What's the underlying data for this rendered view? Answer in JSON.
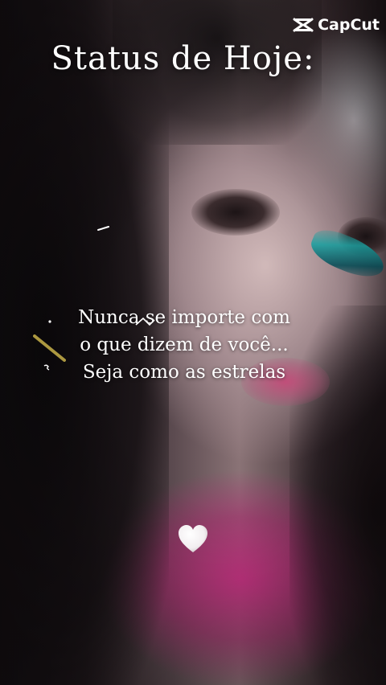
{
  "watermark": {
    "brand": "CapCut",
    "icon": "capcut-logo-icon"
  },
  "title": "Status de Hoje:",
  "quote": {
    "lines": [
      "Nunca se importe com",
      "o que dizem de você...",
      "Seja como as estrelas"
    ]
  },
  "decorations": {
    "heart_icon": "white-heart-icon",
    "sparkle_icon": "sparkle-icon"
  },
  "colors": {
    "text": "#ffffff",
    "lip_pink": "#c8467a",
    "top_magenta": "#cc2882",
    "butterfly_teal": "#1ea0a0"
  }
}
